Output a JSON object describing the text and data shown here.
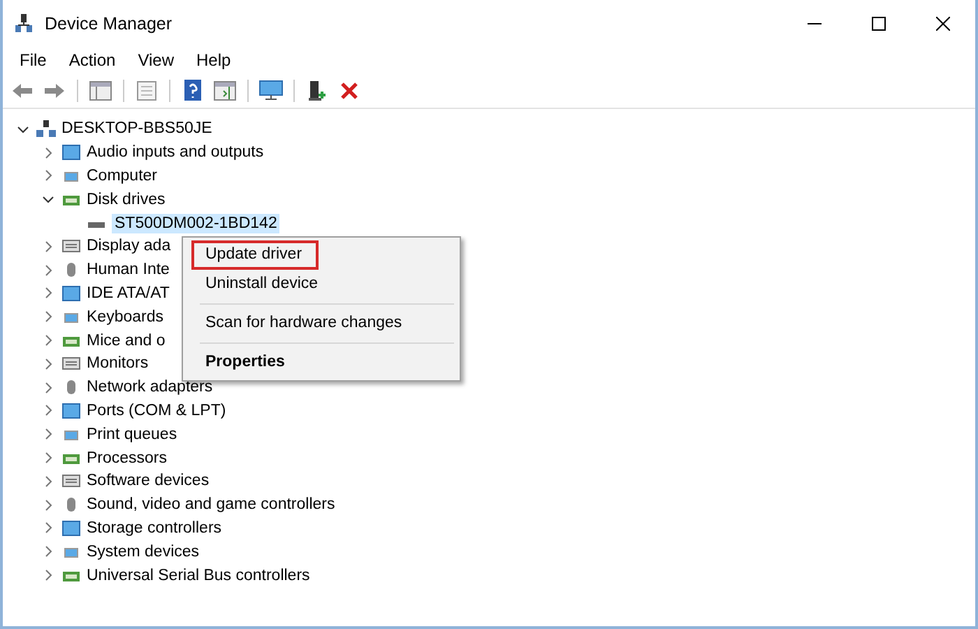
{
  "window": {
    "title": "Device Manager"
  },
  "menu_bar": [
    "File",
    "Action",
    "View",
    "Help"
  ],
  "tree": {
    "label": "DESKTOP-BBS50JE",
    "expanded": true,
    "children": [
      {
        "label": "Audio inputs and outputs",
        "expanded": false
      },
      {
        "label": "Computer",
        "expanded": false
      },
      {
        "label": "Disk drives",
        "expanded": true,
        "children": [
          {
            "label": "ST500DM002-1BD142"
          }
        ]
      },
      {
        "label": "Display ada",
        "expanded": false
      },
      {
        "label": "Human Inte",
        "expanded": false
      },
      {
        "label": "IDE ATA/AT",
        "expanded": false
      },
      {
        "label": "Keyboards",
        "expanded": false
      },
      {
        "label": "Mice and o",
        "expanded": false
      },
      {
        "label": "Monitors",
        "expanded": false
      },
      {
        "label": "Network adapters",
        "expanded": false
      },
      {
        "label": "Ports (COM & LPT)",
        "expanded": false
      },
      {
        "label": "Print queues",
        "expanded": false
      },
      {
        "label": "Processors",
        "expanded": false
      },
      {
        "label": "Software devices",
        "expanded": false
      },
      {
        "label": "Sound, video and game controllers",
        "expanded": false
      },
      {
        "label": "Storage controllers",
        "expanded": false
      },
      {
        "label": "System devices",
        "expanded": false
      },
      {
        "label": "Universal Serial Bus controllers",
        "expanded": false
      }
    ]
  },
  "context_menu": {
    "items": [
      {
        "kind": "item",
        "label": "Update driver",
        "highlighted": true,
        "default": false
      },
      {
        "kind": "item",
        "label": "Uninstall device",
        "highlighted": false,
        "default": false
      },
      {
        "kind": "separator"
      },
      {
        "kind": "item",
        "label": "Scan for hardware changes",
        "highlighted": false,
        "default": false
      },
      {
        "kind": "separator"
      },
      {
        "kind": "item",
        "label": "Properties",
        "highlighted": false,
        "default": true
      }
    ]
  }
}
